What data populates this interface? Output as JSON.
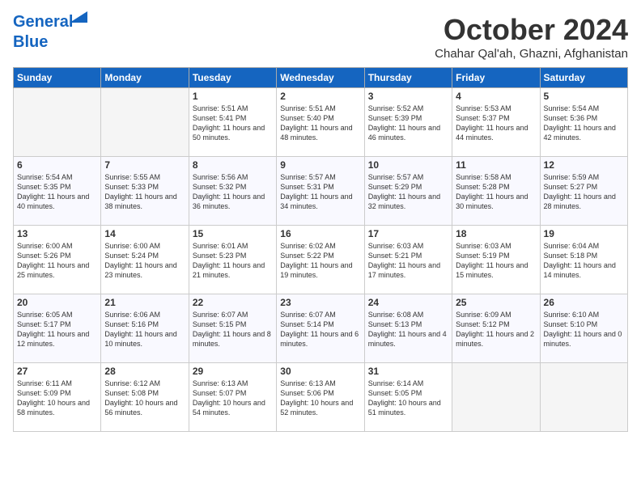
{
  "header": {
    "logo_line1": "General",
    "logo_line2": "Blue",
    "month": "October 2024",
    "location": "Chahar Qal'ah, Ghazni, Afghanistan"
  },
  "days_of_week": [
    "Sunday",
    "Monday",
    "Tuesday",
    "Wednesday",
    "Thursday",
    "Friday",
    "Saturday"
  ],
  "weeks": [
    [
      {
        "day": "",
        "empty": true
      },
      {
        "day": "",
        "empty": true
      },
      {
        "day": "1",
        "sunrise": "Sunrise: 5:51 AM",
        "sunset": "Sunset: 5:41 PM",
        "daylight": "Daylight: 11 hours and 50 minutes."
      },
      {
        "day": "2",
        "sunrise": "Sunrise: 5:51 AM",
        "sunset": "Sunset: 5:40 PM",
        "daylight": "Daylight: 11 hours and 48 minutes."
      },
      {
        "day": "3",
        "sunrise": "Sunrise: 5:52 AM",
        "sunset": "Sunset: 5:39 PM",
        "daylight": "Daylight: 11 hours and 46 minutes."
      },
      {
        "day": "4",
        "sunrise": "Sunrise: 5:53 AM",
        "sunset": "Sunset: 5:37 PM",
        "daylight": "Daylight: 11 hours and 44 minutes."
      },
      {
        "day": "5",
        "sunrise": "Sunrise: 5:54 AM",
        "sunset": "Sunset: 5:36 PM",
        "daylight": "Daylight: 11 hours and 42 minutes."
      }
    ],
    [
      {
        "day": "6",
        "sunrise": "Sunrise: 5:54 AM",
        "sunset": "Sunset: 5:35 PM",
        "daylight": "Daylight: 11 hours and 40 minutes."
      },
      {
        "day": "7",
        "sunrise": "Sunrise: 5:55 AM",
        "sunset": "Sunset: 5:33 PM",
        "daylight": "Daylight: 11 hours and 38 minutes."
      },
      {
        "day": "8",
        "sunrise": "Sunrise: 5:56 AM",
        "sunset": "Sunset: 5:32 PM",
        "daylight": "Daylight: 11 hours and 36 minutes."
      },
      {
        "day": "9",
        "sunrise": "Sunrise: 5:57 AM",
        "sunset": "Sunset: 5:31 PM",
        "daylight": "Daylight: 11 hours and 34 minutes."
      },
      {
        "day": "10",
        "sunrise": "Sunrise: 5:57 AM",
        "sunset": "Sunset: 5:29 PM",
        "daylight": "Daylight: 11 hours and 32 minutes."
      },
      {
        "day": "11",
        "sunrise": "Sunrise: 5:58 AM",
        "sunset": "Sunset: 5:28 PM",
        "daylight": "Daylight: 11 hours and 30 minutes."
      },
      {
        "day": "12",
        "sunrise": "Sunrise: 5:59 AM",
        "sunset": "Sunset: 5:27 PM",
        "daylight": "Daylight: 11 hours and 28 minutes."
      }
    ],
    [
      {
        "day": "13",
        "sunrise": "Sunrise: 6:00 AM",
        "sunset": "Sunset: 5:26 PM",
        "daylight": "Daylight: 11 hours and 25 minutes."
      },
      {
        "day": "14",
        "sunrise": "Sunrise: 6:00 AM",
        "sunset": "Sunset: 5:24 PM",
        "daylight": "Daylight: 11 hours and 23 minutes."
      },
      {
        "day": "15",
        "sunrise": "Sunrise: 6:01 AM",
        "sunset": "Sunset: 5:23 PM",
        "daylight": "Daylight: 11 hours and 21 minutes."
      },
      {
        "day": "16",
        "sunrise": "Sunrise: 6:02 AM",
        "sunset": "Sunset: 5:22 PM",
        "daylight": "Daylight: 11 hours and 19 minutes."
      },
      {
        "day": "17",
        "sunrise": "Sunrise: 6:03 AM",
        "sunset": "Sunset: 5:21 PM",
        "daylight": "Daylight: 11 hours and 17 minutes."
      },
      {
        "day": "18",
        "sunrise": "Sunrise: 6:03 AM",
        "sunset": "Sunset: 5:19 PM",
        "daylight": "Daylight: 11 hours and 15 minutes."
      },
      {
        "day": "19",
        "sunrise": "Sunrise: 6:04 AM",
        "sunset": "Sunset: 5:18 PM",
        "daylight": "Daylight: 11 hours and 14 minutes."
      }
    ],
    [
      {
        "day": "20",
        "sunrise": "Sunrise: 6:05 AM",
        "sunset": "Sunset: 5:17 PM",
        "daylight": "Daylight: 11 hours and 12 minutes."
      },
      {
        "day": "21",
        "sunrise": "Sunrise: 6:06 AM",
        "sunset": "Sunset: 5:16 PM",
        "daylight": "Daylight: 11 hours and 10 minutes."
      },
      {
        "day": "22",
        "sunrise": "Sunrise: 6:07 AM",
        "sunset": "Sunset: 5:15 PM",
        "daylight": "Daylight: 11 hours and 8 minutes."
      },
      {
        "day": "23",
        "sunrise": "Sunrise: 6:07 AM",
        "sunset": "Sunset: 5:14 PM",
        "daylight": "Daylight: 11 hours and 6 minutes."
      },
      {
        "day": "24",
        "sunrise": "Sunrise: 6:08 AM",
        "sunset": "Sunset: 5:13 PM",
        "daylight": "Daylight: 11 hours and 4 minutes."
      },
      {
        "day": "25",
        "sunrise": "Sunrise: 6:09 AM",
        "sunset": "Sunset: 5:12 PM",
        "daylight": "Daylight: 11 hours and 2 minutes."
      },
      {
        "day": "26",
        "sunrise": "Sunrise: 6:10 AM",
        "sunset": "Sunset: 5:10 PM",
        "daylight": "Daylight: 11 hours and 0 minutes."
      }
    ],
    [
      {
        "day": "27",
        "sunrise": "Sunrise: 6:11 AM",
        "sunset": "Sunset: 5:09 PM",
        "daylight": "Daylight: 10 hours and 58 minutes."
      },
      {
        "day": "28",
        "sunrise": "Sunrise: 6:12 AM",
        "sunset": "Sunset: 5:08 PM",
        "daylight": "Daylight: 10 hours and 56 minutes."
      },
      {
        "day": "29",
        "sunrise": "Sunrise: 6:13 AM",
        "sunset": "Sunset: 5:07 PM",
        "daylight": "Daylight: 10 hours and 54 minutes."
      },
      {
        "day": "30",
        "sunrise": "Sunrise: 6:13 AM",
        "sunset": "Sunset: 5:06 PM",
        "daylight": "Daylight: 10 hours and 52 minutes."
      },
      {
        "day": "31",
        "sunrise": "Sunrise: 6:14 AM",
        "sunset": "Sunset: 5:05 PM",
        "daylight": "Daylight: 10 hours and 51 minutes."
      },
      {
        "day": "",
        "empty": true
      },
      {
        "day": "",
        "empty": true
      }
    ]
  ]
}
